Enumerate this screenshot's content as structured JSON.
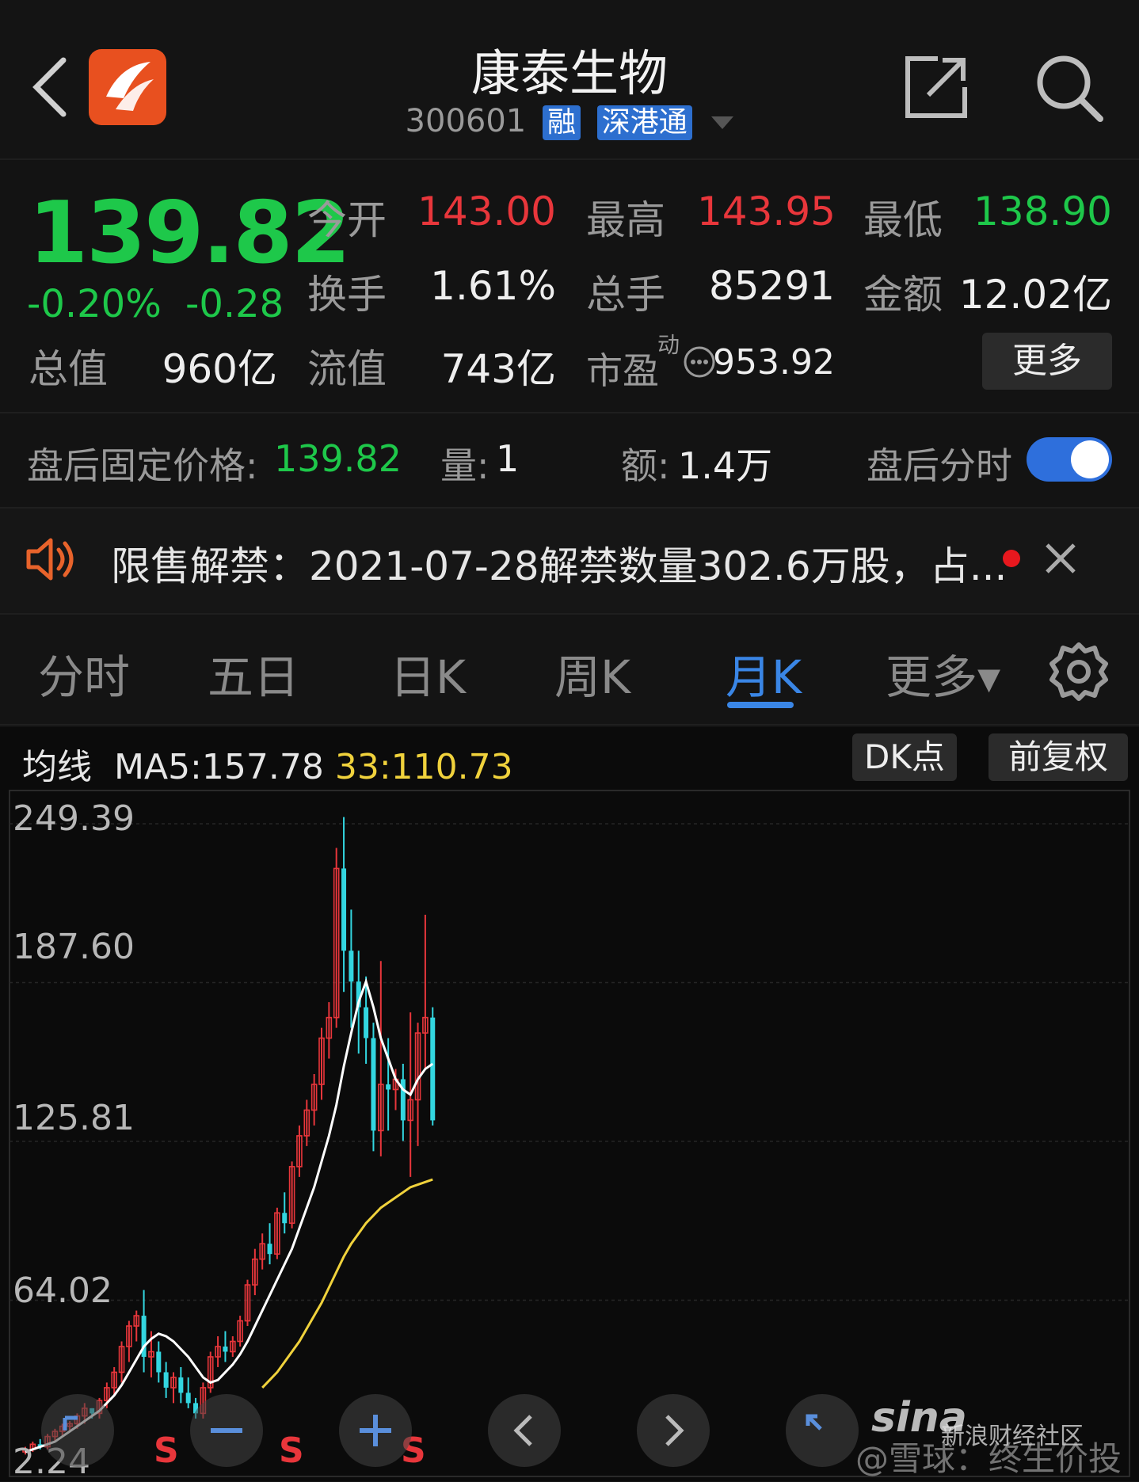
{
  "header": {
    "title": "康泰生物",
    "code": "300601",
    "tags": [
      "融",
      "深港通"
    ]
  },
  "quote": {
    "price": "139.82",
    "change_pct": "-0.20%",
    "change_abs": "-0.28",
    "open_label": "今开",
    "open_value": "143.00",
    "high_label": "最高",
    "high_value": "143.95",
    "low_label": "最低",
    "low_value": "138.90",
    "turnover_label": "换手",
    "turnover_value": "1.61%",
    "volume_label": "总手",
    "volume_value": "85291",
    "amount_label": "金额",
    "amount_value": "12.02亿",
    "mktcap_label": "总值",
    "mktcap_value": "960亿",
    "float_label": "流值",
    "float_value": "743亿",
    "pe_label": "市盈",
    "pe_sup": "动",
    "pe_value": "953.92",
    "more_label": "更多"
  },
  "afterhours": {
    "price_label": "盘后固定价格:",
    "price_value": "139.82",
    "vol_label": "量:",
    "vol_value": "1",
    "amt_label": "额:",
    "amt_value": "1.4万",
    "toggle_label": "盘后分时",
    "toggle_on": true
  },
  "notice": {
    "text": "限售解禁：2021-07-28解禁数量302.6万股，占..."
  },
  "tabs": [
    {
      "label": "分时",
      "active": false
    },
    {
      "label": "五日",
      "active": false
    },
    {
      "label": "日K",
      "active": false
    },
    {
      "label": "周K",
      "active": false
    },
    {
      "label": "月K",
      "active": true
    },
    {
      "label": "更多▾",
      "active": false
    }
  ],
  "chart_header": {
    "ma_label": "均线",
    "ma5_text": "MA5:157.78",
    "ma33_text": "33:110.73",
    "dk_label": "DK点",
    "adjust_label": "前复权"
  },
  "chart_data": {
    "type": "candlestick",
    "y_ticks": [
      "249.39",
      "187.60",
      "125.81",
      "64.02",
      "2.24"
    ],
    "ylim": [
      2.24,
      249.39
    ],
    "candles": [
      [
        5,
        7,
        4,
        6
      ],
      [
        6,
        9,
        5,
        8
      ],
      [
        8,
        10,
        6,
        7
      ],
      [
        7,
        12,
        6,
        11
      ],
      [
        11,
        14,
        9,
        13
      ],
      [
        13,
        16,
        11,
        15
      ],
      [
        15,
        17,
        13,
        16
      ],
      [
        16,
        20,
        14,
        19
      ],
      [
        19,
        24,
        16,
        22
      ],
      [
        22,
        22,
        18,
        20
      ],
      [
        20,
        26,
        18,
        25
      ],
      [
        25,
        32,
        22,
        30
      ],
      [
        30,
        38,
        27,
        36
      ],
      [
        36,
        48,
        32,
        46
      ],
      [
        46,
        56,
        40,
        54
      ],
      [
        54,
        60,
        48,
        58
      ],
      [
        58,
        68,
        36,
        42
      ],
      [
        42,
        52,
        34,
        44
      ],
      [
        44,
        48,
        32,
        36
      ],
      [
        36,
        40,
        26,
        30
      ],
      [
        30,
        36,
        24,
        34
      ],
      [
        34,
        38,
        24,
        28
      ],
      [
        28,
        34,
        22,
        24
      ],
      [
        24,
        26,
        18,
        20
      ],
      [
        20,
        32,
        18,
        30
      ],
      [
        30,
        44,
        28,
        42
      ],
      [
        42,
        50,
        38,
        46
      ],
      [
        46,
        52,
        40,
        44
      ],
      [
        44,
        50,
        42,
        48
      ],
      [
        48,
        58,
        46,
        56
      ],
      [
        56,
        72,
        54,
        70
      ],
      [
        70,
        84,
        66,
        80
      ],
      [
        80,
        90,
        76,
        86
      ],
      [
        86,
        94,
        78,
        82
      ],
      [
        82,
        100,
        80,
        98
      ],
      [
        98,
        106,
        90,
        94
      ],
      [
        94,
        118,
        92,
        116
      ],
      [
        116,
        132,
        112,
        128
      ],
      [
        128,
        142,
        124,
        138
      ],
      [
        138,
        152,
        132,
        148
      ],
      [
        148,
        170,
        142,
        166
      ],
      [
        166,
        180,
        158,
        174
      ],
      [
        174,
        240,
        170,
        232
      ],
      [
        232,
        252,
        184,
        200
      ],
      [
        200,
        216,
        170,
        188
      ],
      [
        188,
        200,
        160,
        178
      ],
      [
        178,
        190,
        156,
        166
      ],
      [
        166,
        172,
        122,
        130
      ],
      [
        130,
        196,
        120,
        148
      ],
      [
        148,
        166,
        130,
        146
      ],
      [
        146,
        154,
        138,
        150
      ],
      [
        150,
        156,
        126,
        134
      ],
      [
        134,
        176,
        112,
        142
      ],
      [
        142,
        172,
        124,
        168
      ],
      [
        168,
        214,
        154,
        174
      ],
      [
        174,
        178,
        132,
        134
      ]
    ],
    "ma5": [
      5,
      6,
      7,
      8,
      9,
      11,
      13,
      15,
      17,
      19,
      21,
      24,
      27,
      31,
      36,
      41,
      46,
      49,
      51,
      50,
      48,
      45,
      42,
      38,
      34,
      32,
      33,
      36,
      39,
      43,
      48,
      54,
      60,
      66,
      72,
      78,
      84,
      92,
      100,
      108,
      118,
      128,
      140,
      155,
      168,
      180,
      188,
      178,
      166,
      158,
      150,
      146,
      144,
      150,
      154,
      156
    ],
    "ma33": [
      null,
      null,
      null,
      null,
      null,
      null,
      null,
      null,
      null,
      null,
      null,
      null,
      null,
      null,
      null,
      null,
      null,
      null,
      null,
      null,
      null,
      null,
      null,
      null,
      null,
      null,
      null,
      null,
      null,
      null,
      null,
      null,
      30,
      33,
      36,
      40,
      44,
      48,
      53,
      58,
      63,
      69,
      75,
      81,
      86,
      90,
      94,
      97,
      100,
      102,
      104,
      106,
      108,
      109,
      110,
      111
    ],
    "markers": [
      "S",
      "S",
      "S"
    ]
  },
  "watermark": {
    "logo": "sina",
    "sub": "新浪财经社区",
    "text": "@雪球：终生价投"
  }
}
